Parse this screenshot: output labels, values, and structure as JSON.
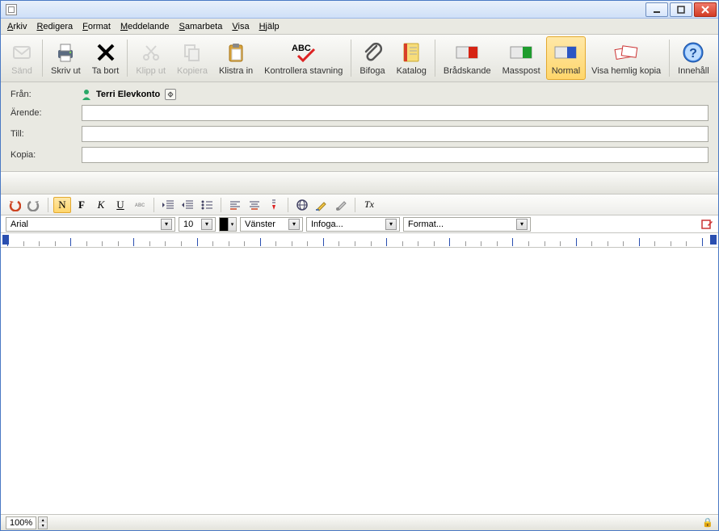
{
  "menus": {
    "arkiv": "Arkiv",
    "redigera": "Redigera",
    "format": "Format",
    "meddelande": "Meddelande",
    "samarbeta": "Samarbeta",
    "visa": "Visa",
    "hjalp": "Hjälp"
  },
  "toolbar": {
    "sand": "Sänd",
    "skriv_ut": "Skriv ut",
    "ta_bort": "Ta bort",
    "klipp_ut": "Klipp ut",
    "kopiera": "Kopiera",
    "klistra_in": "Klistra in",
    "kontrollera": "Kontrollera stavning",
    "bifoga": "Bifoga",
    "katalog": "Katalog",
    "bradskande": "Brådskande",
    "masspost": "Masspost",
    "normal": "Normal",
    "visa_hemlig": "Visa hemlig kopia",
    "innehall": "Innehåll"
  },
  "fields": {
    "fran_label": "Från:",
    "fran_value": "Terri Elevkonto",
    "arende_label": "Ärende:",
    "till_label": "Till:",
    "kopia_label": "Kopia:"
  },
  "format_bar": {
    "normal": "N",
    "bold": "F",
    "italic": "K",
    "underline": "U"
  },
  "font_row": {
    "font": "Arial",
    "size": "10",
    "align": "Vänster",
    "insert": "Infoga...",
    "format": "Format..."
  },
  "status": {
    "zoom": "100%"
  }
}
